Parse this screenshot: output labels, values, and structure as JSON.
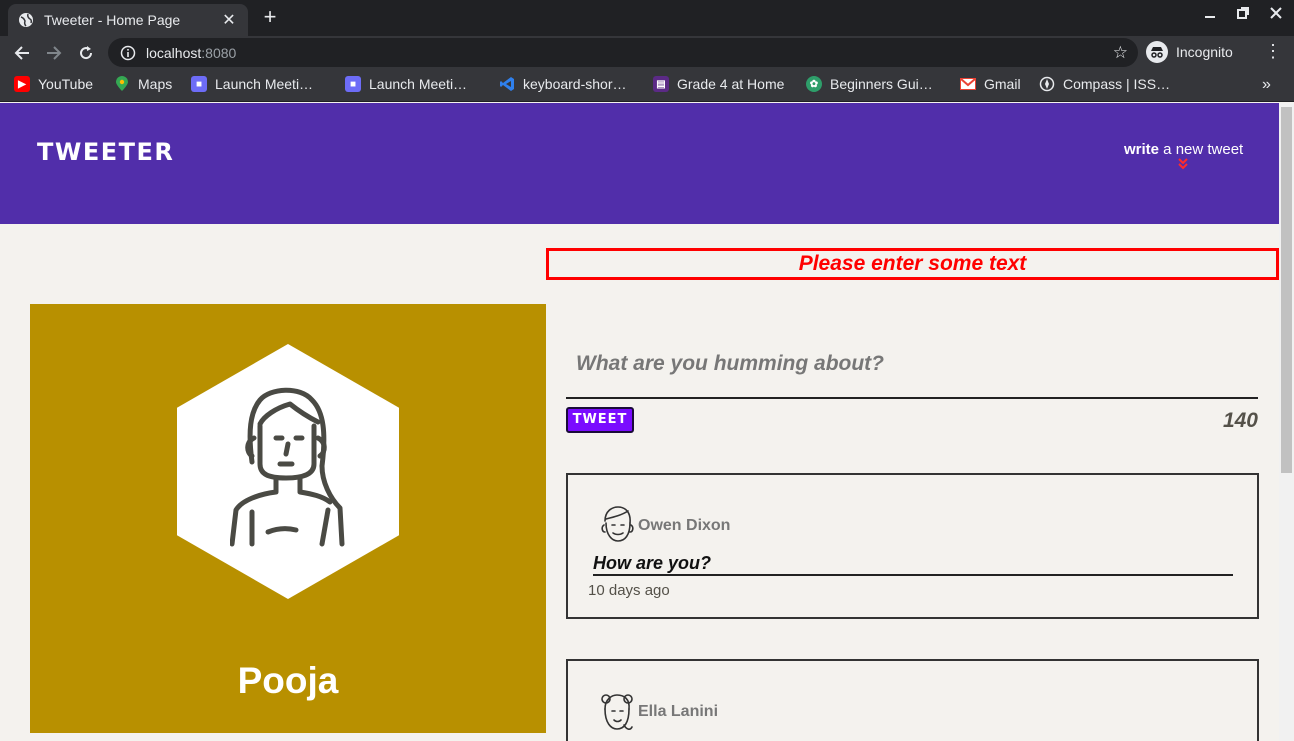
{
  "browser": {
    "tab_title": "Tweeter - Home Page",
    "tab_close": "✕",
    "new_tab": "+",
    "url_host": "localhost",
    "url_port": ":8080",
    "incognito_label": "Incognito",
    "bookmarks": [
      {
        "label": "YouTube",
        "icon": "youtube-icon",
        "color": "#ff0000"
      },
      {
        "label": "Maps",
        "icon": "maps-icon",
        "color": "#34a853"
      },
      {
        "label": "Launch Meeti…",
        "icon": "zoom-icon",
        "color": "#6d6cf7"
      },
      {
        "label": "Launch Meeti…",
        "icon": "zoom-icon",
        "color": "#6d6cf7"
      },
      {
        "label": "keyboard-shor…",
        "icon": "vscode-icon",
        "color": "#2f80ed"
      },
      {
        "label": "Grade 4 at Home",
        "icon": "grade-icon",
        "color": "#5b2a86"
      },
      {
        "label": "Beginners Gui…",
        "icon": "guide-icon",
        "color": "#2e9e6a"
      },
      {
        "label": "Gmail",
        "icon": "gmail-icon",
        "color": "#ea4335"
      },
      {
        "label": "Compass | ISS…",
        "icon": "compass-icon",
        "color": "#202124"
      }
    ],
    "bookmarks_more": "»"
  },
  "header": {
    "logo": "TWEETER",
    "write_bold": "write",
    "write_rest": " a new tweet",
    "chevron": "»"
  },
  "error": {
    "message": "Please enter some text"
  },
  "profile": {
    "name": "Pooja"
  },
  "compose": {
    "placeholder": "What are you humming about?",
    "button_label": "TWEET",
    "counter": "140"
  },
  "tweets": [
    {
      "name": "Owen Dixon",
      "body": "How are you?",
      "time": "10 days ago"
    },
    {
      "name": "Ella Lanini",
      "body": "",
      "time": ""
    }
  ],
  "colors": {
    "header_bg": "#512eaa",
    "profile_bg": "#b89000",
    "error": "#ff0000",
    "tweet_button": "#7a0cff"
  }
}
